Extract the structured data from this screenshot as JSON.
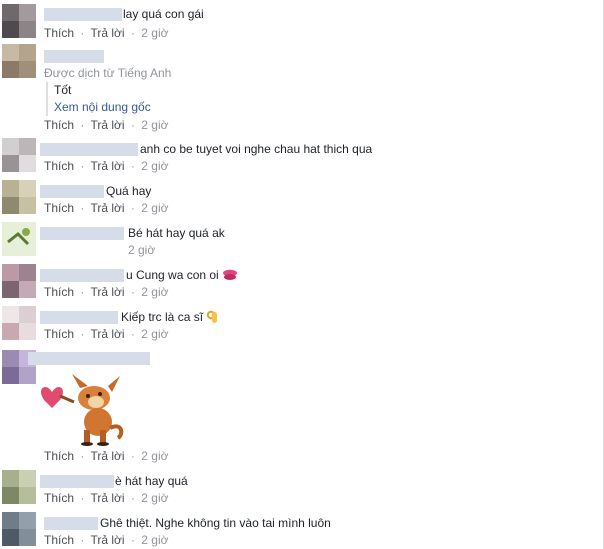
{
  "actions": {
    "like": "Thích",
    "reply": "Trả lời",
    "sep": "·"
  },
  "comments": [
    {
      "text": "lay quá con gái",
      "time": "2 giờ"
    },
    {
      "translated_label": "Được dịch từ Tiếng Anh",
      "translated_text": "Tốt",
      "see_original": "Xem nội dung gốc",
      "time": "2 giờ"
    },
    {
      "text": "anh co be tuyet voi nghe chau hat thich qua",
      "time": "2 giờ"
    },
    {
      "text": "Quá hay",
      "time": "2 giờ"
    },
    {
      "text": "Bé hát hay quá ak",
      "time": "2 giờ"
    },
    {
      "text": "u Cung wa con oi",
      "emoji": "kiss-icon",
      "time": "2 giờ"
    },
    {
      "text": "Kiếp trc là ca sĩ",
      "emoji": "ok-hand-icon",
      "time": "2 giờ"
    },
    {
      "sticker": "dog-heart-sticker",
      "time": "2 giờ"
    },
    {
      "text": "è hát hay quá",
      "time": "2 giờ"
    },
    {
      "text": "Ghê thiệt. Nghe không tin vào tai mình luôn",
      "time": "2 giờ"
    }
  ]
}
